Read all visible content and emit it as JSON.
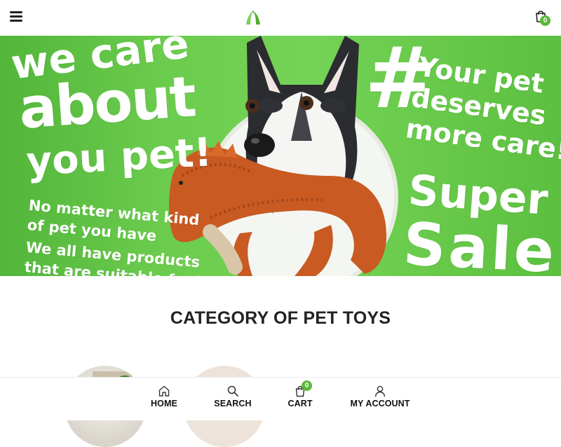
{
  "header": {
    "menu_icon": "hamburger-menu-icon",
    "logo_icon": "brand-logo-icon",
    "cart_icon": "shopping-bag-icon",
    "cart_count": "0"
  },
  "banner": {
    "line_we_care": "we care",
    "line_about": "about",
    "line_you_pet": "you pet!",
    "sub_1": "No matter what kind",
    "sub_2": "of pet you have",
    "sub_3": "We all have products",
    "sub_4": "that are suitable for it",
    "hash": "#",
    "right_1": "Your pet",
    "right_2": "deserves",
    "right_3": "more care!",
    "super": "Super",
    "sale": "Sale"
  },
  "section": {
    "title": "CATEGORY OF PET TOYS"
  },
  "bottom_nav": {
    "home": "HOME",
    "search": "SEARCH",
    "cart": "CART",
    "cart_count": "0",
    "account": "MY ACCOUNT"
  },
  "colors": {
    "accent": "#5cb639",
    "banner_green": "#6ccc4e",
    "text": "#222222"
  }
}
